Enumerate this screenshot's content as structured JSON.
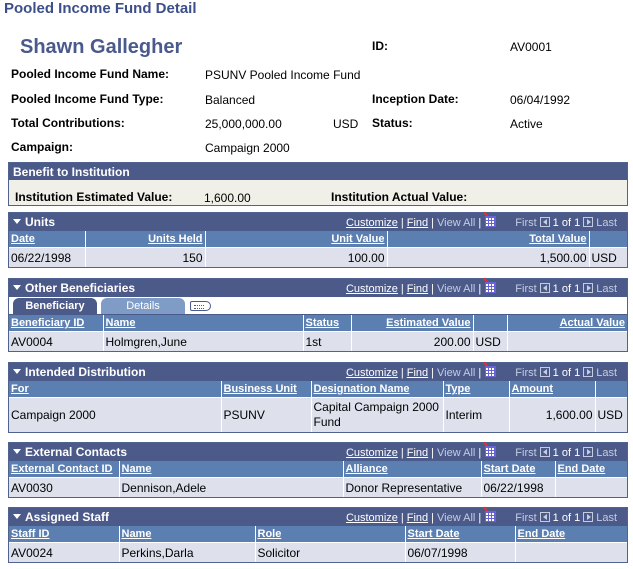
{
  "page_title": "Pooled Income Fund Detail",
  "header": {
    "name": "Shawn Gallegher",
    "id_label": "ID:",
    "id_value": "AV0001",
    "fund_name_label": "Pooled Income Fund Name:",
    "fund_name_value": "PSUNV Pooled Income Fund",
    "fund_type_label": "Pooled Income Fund Type:",
    "fund_type_value": "Balanced",
    "inception_label": "Inception Date:",
    "inception_value": "06/04/1992",
    "contrib_label": "Total Contributions:",
    "contrib_value": "25,000,000.00",
    "contrib_currency": "USD",
    "status_label": "Status:",
    "status_value": "Active",
    "campaign_label": "Campaign:",
    "campaign_value": "Campaign 2000"
  },
  "benefit": {
    "title": "Benefit to Institution",
    "est_label": "Institution Estimated Value:",
    "est_value": "1,600.00",
    "actual_label": "Institution Actual Value:",
    "actual_value": ""
  },
  "nav": {
    "customize": "Customize",
    "find": "Find",
    "view_all": "View All",
    "sep": "|",
    "first": "First",
    "pager": "1 of 1",
    "last": "Last"
  },
  "units": {
    "title": "Units",
    "columns": [
      "Date",
      "Units Held",
      "Unit Value",
      "Total Value",
      ""
    ],
    "rows": [
      [
        "06/22/1998",
        "150",
        "100.00",
        "1,500.00",
        "USD"
      ]
    ]
  },
  "beneficiaries": {
    "title": "Other Beneficiaries",
    "tabs": [
      "Beneficiary",
      "Details"
    ],
    "columns": [
      "Beneficiary ID",
      "Name",
      "Status",
      "Estimated Value",
      "",
      "Actual Value"
    ],
    "rows": [
      [
        "AV0004",
        "Holmgren,June",
        "1st",
        "200.00",
        "USD",
        ""
      ]
    ]
  },
  "distribution": {
    "title": "Intended Distribution",
    "columns": [
      "For",
      "Business Unit",
      "Designation Name",
      "Type",
      "Amount",
      ""
    ],
    "rows": [
      [
        "Campaign 2000",
        "PSUNV",
        "Capital Campaign 2000 Fund",
        "Interim",
        "1,600.00",
        "USD"
      ]
    ]
  },
  "contacts": {
    "title": "External Contacts",
    "columns": [
      "External Contact ID",
      "Name",
      "Alliance",
      "Start Date",
      "End Date"
    ],
    "rows": [
      [
        "AV0030",
        "Dennison,Adele",
        "Donor Representative",
        "06/22/1998",
        ""
      ]
    ]
  },
  "staff": {
    "title": "Assigned Staff",
    "columns": [
      "Staff ID",
      "Name",
      "Role",
      "Start Date",
      "End Date"
    ],
    "rows": [
      [
        "AV0024",
        "Perkins,Darla",
        "Solicitor",
        "06/07/1998",
        ""
      ]
    ]
  }
}
